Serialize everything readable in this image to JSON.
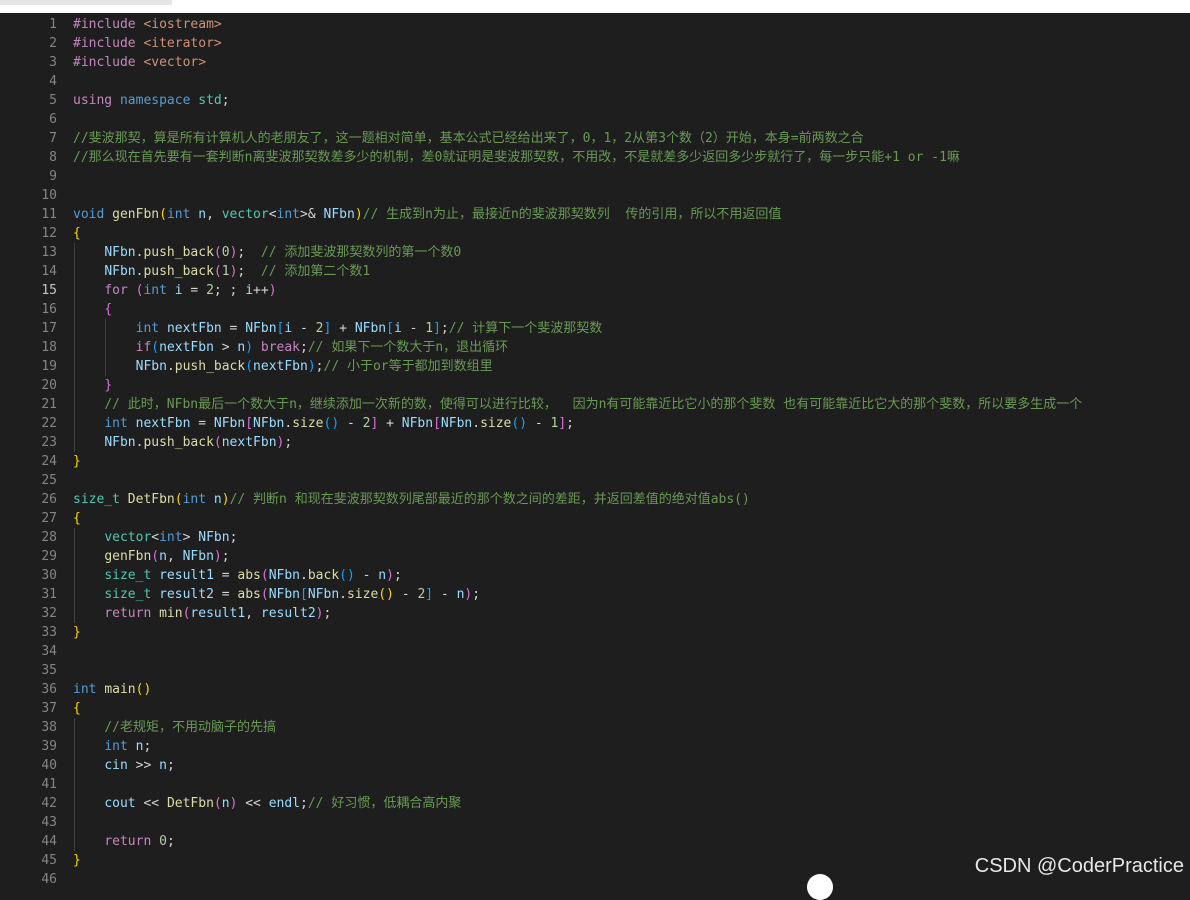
{
  "window": {
    "title": ""
  },
  "editor": {
    "current_line": "15",
    "lines": [
      {
        "num": "1",
        "tokens": [
          [
            "c",
            "#include "
          ],
          [
            "s",
            "<iostream>"
          ]
        ]
      },
      {
        "num": "2",
        "tokens": [
          [
            "c",
            "#include "
          ],
          [
            "s",
            "<iterator>"
          ]
        ]
      },
      {
        "num": "3",
        "tokens": [
          [
            "c",
            "#include "
          ],
          [
            "s",
            "<vector>"
          ]
        ]
      },
      {
        "num": "4",
        "tokens": []
      },
      {
        "num": "5",
        "tokens": [
          [
            "c",
            "using "
          ],
          [
            "k",
            "namespace "
          ],
          [
            "t",
            "std"
          ],
          [
            "",
            "; "
          ]
        ]
      },
      {
        "num": "6",
        "tokens": []
      },
      {
        "num": "7",
        "tokens": [
          [
            "cm",
            "//斐波那契，算是所有计算机人的老朋友了，这一题相对简单，基本公式已经给出来了，0，1，2从第3个数（2）开始，本身=前两数之合"
          ]
        ]
      },
      {
        "num": "8",
        "tokens": [
          [
            "cm",
            "//那么现在首先要有一套判断n离斐波那契数差多少的机制，差0就证明是斐波那契数，不用改，不是就差多少返回多少步就行了，每一步只能+1 or -1嘛"
          ]
        ]
      },
      {
        "num": "9",
        "tokens": []
      },
      {
        "num": "10",
        "tokens": []
      },
      {
        "num": "11",
        "tokens": [
          [
            "k",
            "void "
          ],
          [
            "f",
            "genFbn"
          ],
          [
            "p",
            "("
          ],
          [
            "k",
            "int "
          ],
          [
            "v",
            "n"
          ],
          [
            "",
            ", "
          ],
          [
            "t",
            "vector"
          ],
          [
            "",
            "<"
          ],
          [
            "k",
            "int"
          ],
          [
            "",
            ">& "
          ],
          [
            "v",
            "NFbn"
          ],
          [
            "p",
            ")"
          ],
          [
            "cm",
            "// 生成到n为止，最接近n的斐波那契数列  传的引用，所以不用返回值"
          ]
        ]
      },
      {
        "num": "12",
        "tokens": [
          [
            "p",
            "{"
          ]
        ]
      },
      {
        "num": "13",
        "tokens": [
          [
            "",
            "    "
          ],
          [
            "v",
            "NFbn"
          ],
          [
            "",
            "."
          ],
          [
            "f",
            "push_back"
          ],
          [
            "p2",
            "("
          ],
          [
            "n",
            "0"
          ],
          [
            "p2",
            ")"
          ],
          [
            "",
            ";  "
          ],
          [
            "cm",
            "// 添加斐波那契数列的第一个数0"
          ]
        ]
      },
      {
        "num": "14",
        "tokens": [
          [
            "",
            "    "
          ],
          [
            "v",
            "NFbn"
          ],
          [
            "",
            "."
          ],
          [
            "f",
            "push_back"
          ],
          [
            "p2",
            "("
          ],
          [
            "n",
            "1"
          ],
          [
            "p2",
            ")"
          ],
          [
            "",
            ";  "
          ],
          [
            "cm",
            "// 添加第二个数1"
          ]
        ]
      },
      {
        "num": "15",
        "tokens": [
          [
            "",
            "    "
          ],
          [
            "c",
            "for "
          ],
          [
            "p2",
            "("
          ],
          [
            "k",
            "int "
          ],
          [
            "v",
            "i"
          ],
          [
            "",
            " = "
          ],
          [
            "n",
            "2"
          ],
          [
            "",
            "; ; "
          ],
          [
            "v",
            "i"
          ],
          [
            "",
            "++"
          ],
          [
            "p2",
            ")"
          ]
        ]
      },
      {
        "num": "16",
        "tokens": [
          [
            "",
            "    "
          ],
          [
            "p2",
            "{"
          ]
        ]
      },
      {
        "num": "17",
        "tokens": [
          [
            "",
            "        "
          ],
          [
            "k",
            "int "
          ],
          [
            "v",
            "nextFbn"
          ],
          [
            "",
            " = "
          ],
          [
            "v",
            "NFbn"
          ],
          [
            "p3",
            "["
          ],
          [
            "v",
            "i"
          ],
          [
            "",
            " - "
          ],
          [
            "n",
            "2"
          ],
          [
            "p3",
            "]"
          ],
          [
            "",
            " + "
          ],
          [
            "v",
            "NFbn"
          ],
          [
            "p3",
            "["
          ],
          [
            "v",
            "i"
          ],
          [
            "",
            " - "
          ],
          [
            "n",
            "1"
          ],
          [
            "p3",
            "]"
          ],
          [
            ";"
          ],
          [
            "cm",
            "// 计算下一个斐波那契数"
          ]
        ]
      },
      {
        "num": "18",
        "tokens": [
          [
            "",
            "        "
          ],
          [
            "c",
            "if"
          ],
          [
            "p3",
            "("
          ],
          [
            "v",
            "nextFbn"
          ],
          [
            "",
            " > "
          ],
          [
            "v",
            "n"
          ],
          [
            "p3",
            ")"
          ],
          [
            "c",
            " break"
          ],
          [
            "",
            ";"
          ],
          [
            "cm",
            "// 如果下一个数大于n，退出循环"
          ]
        ]
      },
      {
        "num": "19",
        "tokens": [
          [
            "",
            "        "
          ],
          [
            "v",
            "NFbn"
          ],
          [
            "",
            "."
          ],
          [
            "f",
            "push_back"
          ],
          [
            "p3",
            "("
          ],
          [
            "v",
            "nextFbn"
          ],
          [
            "p3",
            ")"
          ],
          [
            "",
            ";"
          ],
          [
            "cm",
            "// 小于or等于都加到数组里"
          ]
        ]
      },
      {
        "num": "20",
        "tokens": [
          [
            "",
            "    "
          ],
          [
            "p2",
            "}"
          ]
        ]
      },
      {
        "num": "21",
        "tokens": [
          [
            "",
            "    "
          ],
          [
            "cm",
            "// 此时，NFbn最后一个数大于n，继续添加一次新的数，使得可以进行比较，  因为n有可能靠近比它小的那个斐数 也有可能靠近比它大的那个斐数，所以要多生成一个"
          ]
        ]
      },
      {
        "num": "22",
        "tokens": [
          [
            "",
            "    "
          ],
          [
            "k",
            "int "
          ],
          [
            "v",
            "nextFbn"
          ],
          [
            "",
            " = "
          ],
          [
            "v",
            "NFbn"
          ],
          [
            "p2",
            "["
          ],
          [
            "v",
            "NFbn"
          ],
          [
            "",
            "."
          ],
          [
            "f",
            "size"
          ],
          [
            "p3",
            "()"
          ],
          [
            "",
            " - "
          ],
          [
            "n",
            "2"
          ],
          [
            "p2",
            "]"
          ],
          [
            "",
            " + "
          ],
          [
            "v",
            "NFbn"
          ],
          [
            "p2",
            "["
          ],
          [
            "v",
            "NFbn"
          ],
          [
            "",
            "."
          ],
          [
            "f",
            "size"
          ],
          [
            "p3",
            "()"
          ],
          [
            "",
            " - "
          ],
          [
            "n",
            "1"
          ],
          [
            "p2",
            "]"
          ],
          [
            ";"
          ]
        ]
      },
      {
        "num": "23",
        "tokens": [
          [
            "",
            "    "
          ],
          [
            "v",
            "NFbn"
          ],
          [
            "",
            "."
          ],
          [
            "f",
            "push_back"
          ],
          [
            "p2",
            "("
          ],
          [
            "v",
            "nextFbn"
          ],
          [
            "p2",
            ")"
          ],
          [
            ";"
          ]
        ]
      },
      {
        "num": "24",
        "tokens": [
          [
            "p",
            "}"
          ]
        ]
      },
      {
        "num": "25",
        "tokens": []
      },
      {
        "num": "26",
        "tokens": [
          [
            "t",
            "size_t "
          ],
          [
            "f",
            "DetFbn"
          ],
          [
            "p",
            "("
          ],
          [
            "k",
            "int "
          ],
          [
            "v",
            "n"
          ],
          [
            "p",
            ")"
          ],
          [
            "cm",
            "// 判断n 和现在斐波那契数列尾部最近的那个数之间的差距，并返回差值的绝对值abs()"
          ]
        ]
      },
      {
        "num": "27",
        "tokens": [
          [
            "p",
            "{"
          ]
        ]
      },
      {
        "num": "28",
        "tokens": [
          [
            "",
            "    "
          ],
          [
            "t",
            "vector"
          ],
          [
            "",
            "<"
          ],
          [
            "k",
            "int"
          ],
          [
            "",
            "> "
          ],
          [
            "v",
            "NFbn"
          ],
          [
            ";"
          ]
        ]
      },
      {
        "num": "29",
        "tokens": [
          [
            "",
            "    "
          ],
          [
            "f",
            "genFbn"
          ],
          [
            "p2",
            "("
          ],
          [
            "v",
            "n"
          ],
          [
            "",
            ", "
          ],
          [
            "v",
            "NFbn"
          ],
          [
            "p2",
            ")"
          ],
          [
            ";"
          ]
        ]
      },
      {
        "num": "30",
        "tokens": [
          [
            "",
            "    "
          ],
          [
            "t",
            "size_t "
          ],
          [
            "v",
            "result1"
          ],
          [
            "",
            " = "
          ],
          [
            "f",
            "abs"
          ],
          [
            "p2",
            "("
          ],
          [
            "v",
            "NFbn"
          ],
          [
            "",
            "."
          ],
          [
            "f",
            "back"
          ],
          [
            "p3",
            "()"
          ],
          [
            "",
            " - "
          ],
          [
            "v",
            "n"
          ],
          [
            "p2",
            ")"
          ],
          [
            ";"
          ]
        ]
      },
      {
        "num": "31",
        "tokens": [
          [
            "",
            "    "
          ],
          [
            "t",
            "size_t "
          ],
          [
            "v",
            "result2"
          ],
          [
            "",
            " = "
          ],
          [
            "f",
            "abs"
          ],
          [
            "p2",
            "("
          ],
          [
            "v",
            "NFbn"
          ],
          [
            "p3",
            "["
          ],
          [
            "v",
            "NFbn"
          ],
          [
            "",
            "."
          ],
          [
            "f",
            "size"
          ],
          [
            "p",
            "()"
          ],
          [
            "",
            " - "
          ],
          [
            "n",
            "2"
          ],
          [
            "p3",
            "]"
          ],
          [
            "",
            " - "
          ],
          [
            "v",
            "n"
          ],
          [
            "p2",
            ")"
          ],
          [
            ";"
          ]
        ]
      },
      {
        "num": "32",
        "tokens": [
          [
            "",
            "    "
          ],
          [
            "c",
            "return "
          ],
          [
            "f",
            "min"
          ],
          [
            "p2",
            "("
          ],
          [
            "v",
            "result1"
          ],
          [
            "",
            ", "
          ],
          [
            "v",
            "result2"
          ],
          [
            "p2",
            ")"
          ],
          [
            ";"
          ]
        ]
      },
      {
        "num": "33",
        "tokens": [
          [
            "p",
            "}"
          ]
        ]
      },
      {
        "num": "34",
        "tokens": []
      },
      {
        "num": "35",
        "tokens": []
      },
      {
        "num": "36",
        "tokens": [
          [
            "k",
            "int "
          ],
          [
            "f",
            "main"
          ],
          [
            "p",
            "()"
          ]
        ]
      },
      {
        "num": "37",
        "tokens": [
          [
            "p",
            "{"
          ]
        ]
      },
      {
        "num": "38",
        "tokens": [
          [
            "",
            "    "
          ],
          [
            "cm",
            "//老规矩，不用动脑子的先搞"
          ]
        ]
      },
      {
        "num": "39",
        "tokens": [
          [
            "",
            "    "
          ],
          [
            "k",
            "int "
          ],
          [
            "v",
            "n"
          ],
          [
            ";"
          ]
        ]
      },
      {
        "num": "40",
        "tokens": [
          [
            "",
            "    "
          ],
          [
            "v",
            "cin"
          ],
          [
            "",
            " >> "
          ],
          [
            "v",
            "n"
          ],
          [
            ";"
          ]
        ]
      },
      {
        "num": "41",
        "tokens": []
      },
      {
        "num": "42",
        "tokens": [
          [
            "",
            "    "
          ],
          [
            "v",
            "cout"
          ],
          [
            "",
            " << "
          ],
          [
            "f",
            "DetFbn"
          ],
          [
            "p2",
            "("
          ],
          [
            "v",
            "n"
          ],
          [
            "p2",
            ")"
          ],
          [
            "",
            " << "
          ],
          [
            "v",
            "endl"
          ],
          [
            "",
            ";"
          ],
          [
            "cm",
            "// 好习惯，低耦合高内聚"
          ]
        ]
      },
      {
        "num": "43",
        "tokens": []
      },
      {
        "num": "44",
        "tokens": [
          [
            "",
            "    "
          ],
          [
            "c",
            "return "
          ],
          [
            "n",
            "0"
          ],
          [
            ";"
          ]
        ]
      },
      {
        "num": "45",
        "tokens": [
          [
            "p",
            "}"
          ]
        ]
      },
      {
        "num": "46",
        "tokens": []
      }
    ]
  },
  "watermark": {
    "text": "CSDN @CoderPractice"
  },
  "colors": {
    "background": "#1e1e1e",
    "line_number": "#858585",
    "keyword": "#569cd6",
    "control": "#c586c0",
    "function": "#dcdcaa",
    "type": "#4ec9b0",
    "variable": "#9cdcfe",
    "number": "#b5cea8",
    "string": "#ce9178",
    "comment": "#6a9955"
  }
}
